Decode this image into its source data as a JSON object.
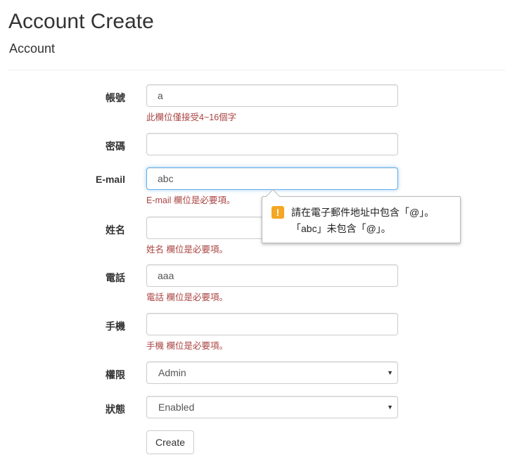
{
  "header": {
    "title": "Account Create",
    "subtitle": "Account"
  },
  "form": {
    "account": {
      "label": "帳號",
      "value": "a",
      "error": "此欄位僅接受4~16個字"
    },
    "password": {
      "label": "密碼",
      "value": ""
    },
    "email": {
      "label": "E-mail",
      "value": "abc",
      "error": "E-mail 欄位是必要項。"
    },
    "name": {
      "label": "姓名",
      "value": "",
      "error": "姓名 欄位是必要項。"
    },
    "phone": {
      "label": "電話",
      "value": "aaa",
      "error": "電話 欄位是必要項。"
    },
    "mobile": {
      "label": "手機",
      "value": "",
      "error": "手機 欄位是必要項。"
    },
    "permission": {
      "label": "權限",
      "selected": "Admin"
    },
    "status": {
      "label": "狀態",
      "selected": "Enabled"
    },
    "submit_label": "Create"
  },
  "tooltip": {
    "icon": "warning-icon",
    "line1": "請在電子郵件地址中包含「@」。",
    "line2": "「abc」未包含「@」。"
  }
}
